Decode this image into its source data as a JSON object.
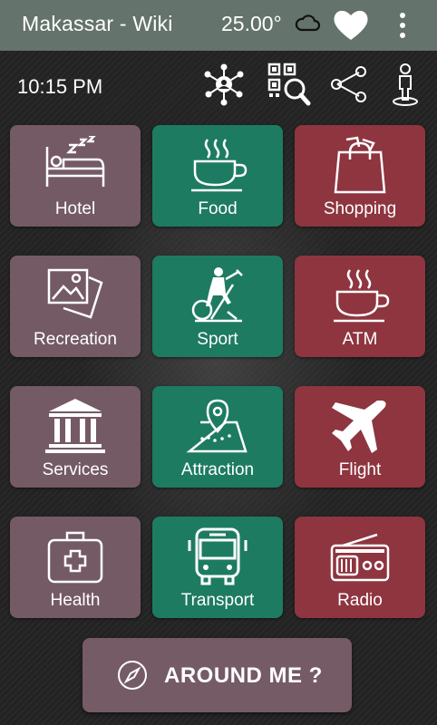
{
  "appbar": {
    "title": "Makassar - Wiki",
    "temperature": "25.00°",
    "weather_icon": "cloud-icon",
    "favorite_icon": "heart-icon",
    "menu_icon": "more-vert-icon",
    "color": "#64736c"
  },
  "status": {
    "time": "10:15 PM",
    "icons": [
      "network-icon",
      "qr-search-icon",
      "share-icon",
      "person-location-icon"
    ]
  },
  "tiles": [
    {
      "label": "Hotel",
      "icon": "bed-icon",
      "color": "#745a65"
    },
    {
      "label": "Food",
      "icon": "coffee-cup-icon",
      "color": "#1d7b61"
    },
    {
      "label": "Shopping",
      "icon": "shopping-bag-icon",
      "color": "#8e3540"
    },
    {
      "label": "Recreation",
      "icon": "pictures-icon",
      "color": "#745a65"
    },
    {
      "label": "Sport",
      "icon": "exercise-bike-icon",
      "color": "#1d7b61"
    },
    {
      "label": "ATM",
      "icon": "coffee-cup-icon",
      "color": "#8e3540"
    },
    {
      "label": "Services",
      "icon": "bank-building-icon",
      "color": "#745a65"
    },
    {
      "label": "Attraction",
      "icon": "map-pin-icon",
      "color": "#1d7b61"
    },
    {
      "label": "Flight",
      "icon": "airplane-icon",
      "color": "#8e3540"
    },
    {
      "label": "Health",
      "icon": "first-aid-kit-icon",
      "color": "#745a65"
    },
    {
      "label": "Transport",
      "icon": "bus-icon",
      "color": "#1d7b61"
    },
    {
      "label": "Radio",
      "icon": "radio-icon",
      "color": "#8e3540"
    }
  ],
  "around_me": {
    "label": "AROUND ME ?",
    "icon": "compass-icon"
  }
}
